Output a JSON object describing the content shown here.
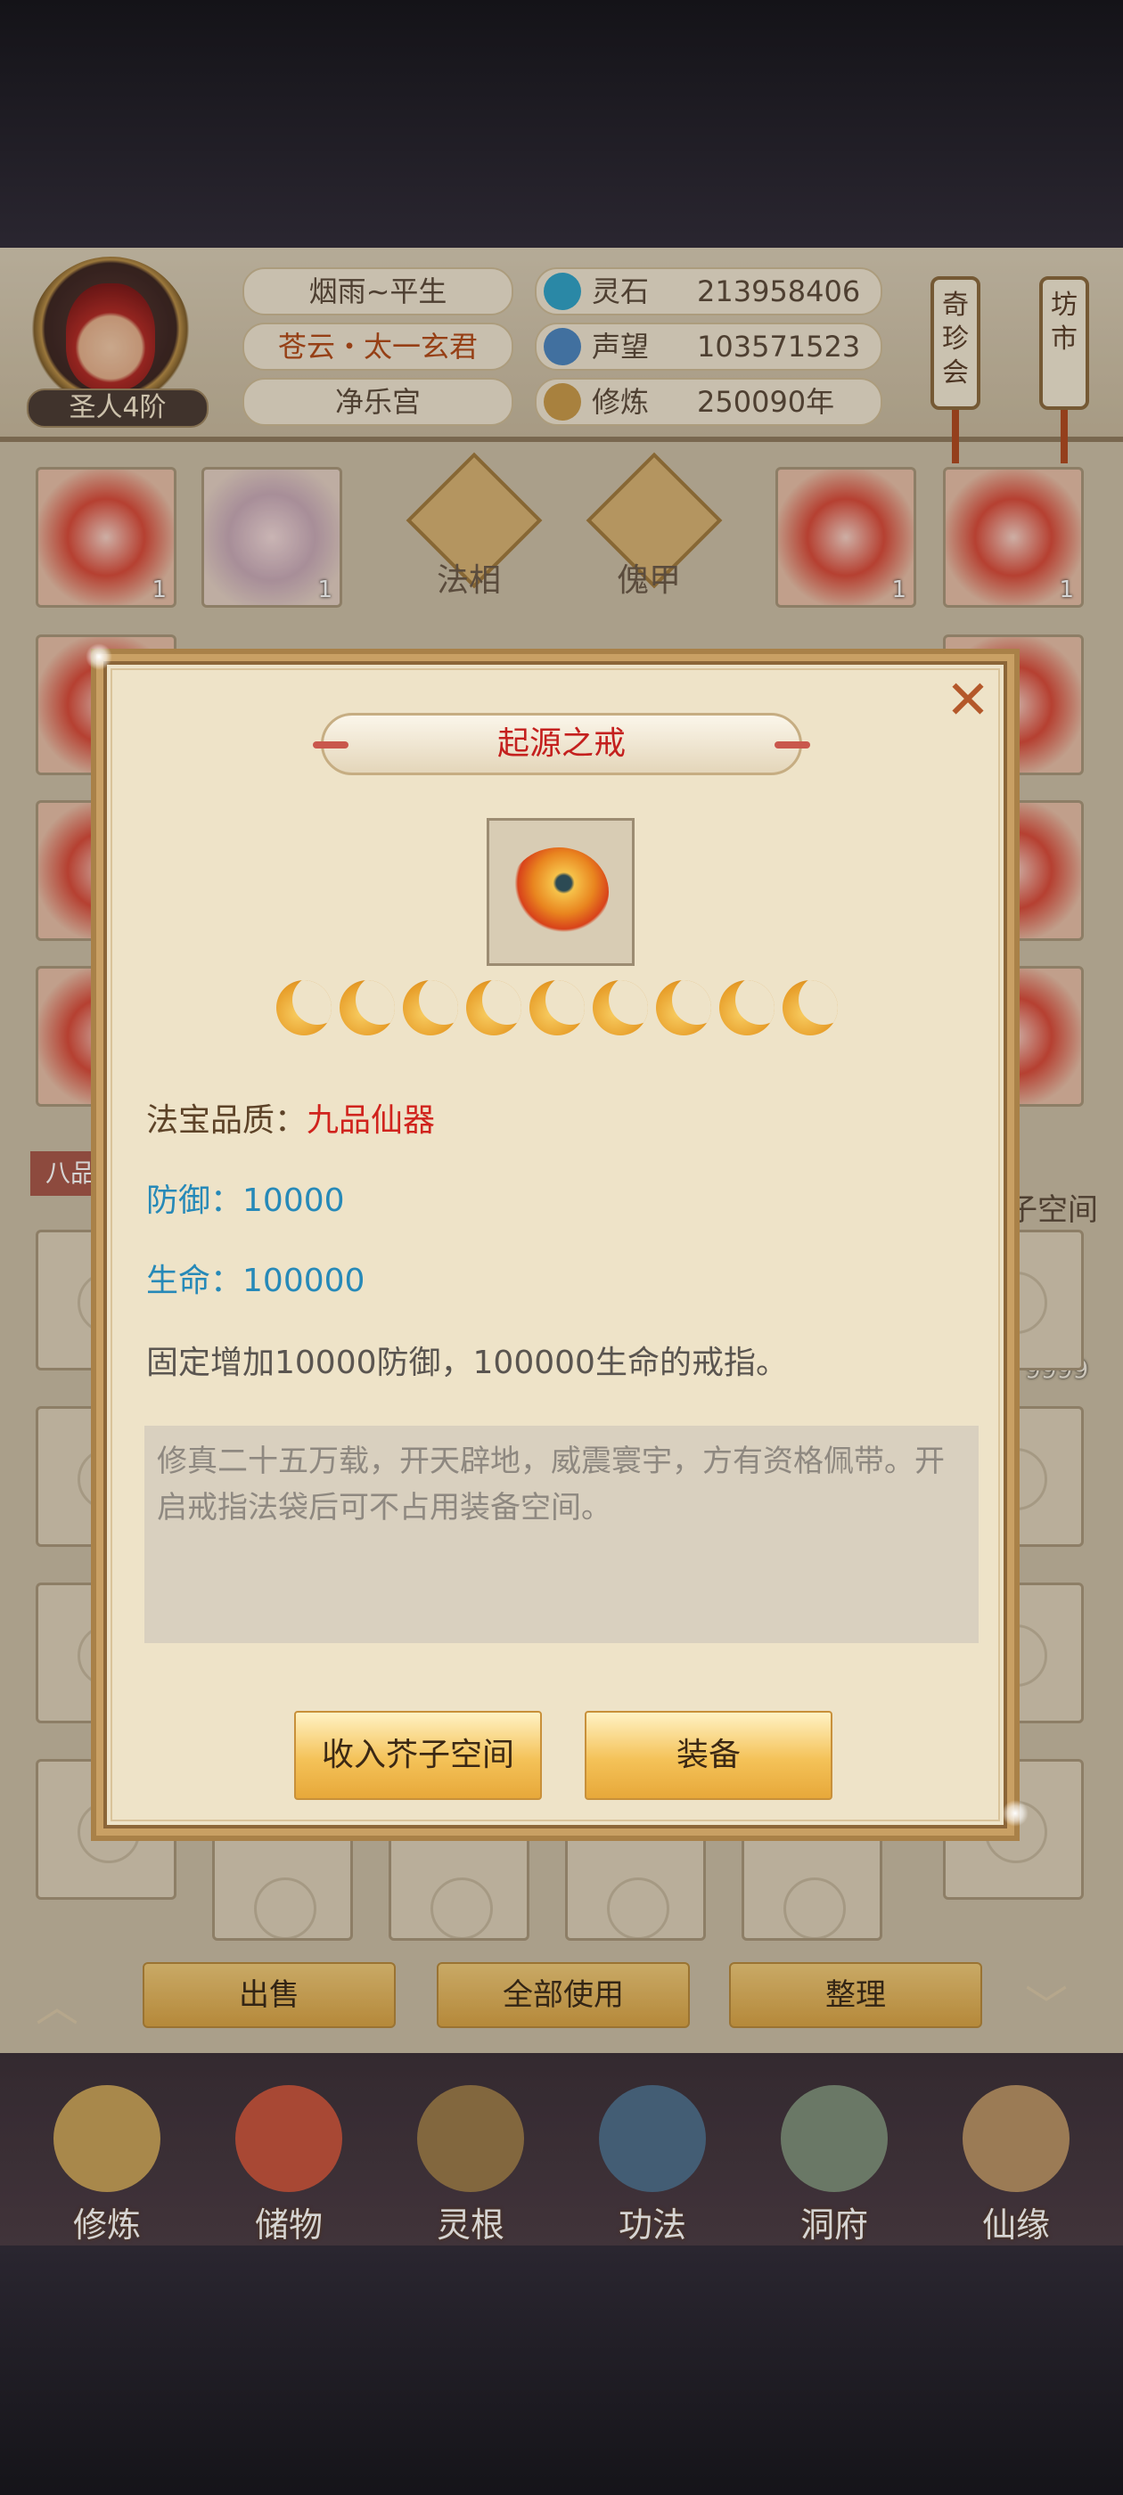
{
  "header": {
    "player_name": "烟雨~平生",
    "guild_name": "苍云・太一玄君",
    "palace": "净乐宫",
    "rank": "圣人4阶",
    "resources": [
      {
        "label": "灵石",
        "value": "213958406",
        "icon": "spirit-stone-icon"
      },
      {
        "label": "声望",
        "value": "103571523",
        "icon": "prestige-icon"
      },
      {
        "label": "修炼",
        "value": "250090年",
        "icon": "cultivation-icon"
      }
    ],
    "shop_buttons": [
      {
        "label": "奇珍会"
      },
      {
        "label": "坊市"
      }
    ]
  },
  "equipment": {
    "center_slots": [
      {
        "label": "法相"
      },
      {
        "label": "傀甲"
      }
    ],
    "slot_counts": [
      "1",
      "1",
      "1",
      "1"
    ],
    "left_tag": "八品",
    "right_tag": "子空间",
    "right_count": "9999"
  },
  "modal": {
    "title": "起源之戒",
    "star_count": 9,
    "quality_label": "法宝品质：",
    "quality_value": "九品仙器",
    "defense_label": "防御：",
    "defense_value": "10000",
    "life_label": "生命：",
    "life_value": "100000",
    "summary": "固定增加10000防御，100000生命的戒指。",
    "lore": "修真二十五万载，开天辟地，威震寰宇，方有资格佩带。开启戒指法袋后可不占用装备空间。",
    "buttons": {
      "store": "收入芥子空间",
      "equip": "装备"
    }
  },
  "bag_actions": {
    "sell": "出售",
    "use_all": "全部使用",
    "sort": "整理"
  },
  "nav": [
    {
      "label": "修炼",
      "color": "#c9a35a"
    },
    {
      "label": "储物",
      "color": "#c8553e"
    },
    {
      "label": "灵根",
      "color": "#9a7a4a"
    },
    {
      "label": "功法",
      "color": "#4d6e8c"
    },
    {
      "label": "洞府",
      "color": "#7d8f7a"
    },
    {
      "label": "仙缘",
      "color": "#b99366"
    }
  ]
}
